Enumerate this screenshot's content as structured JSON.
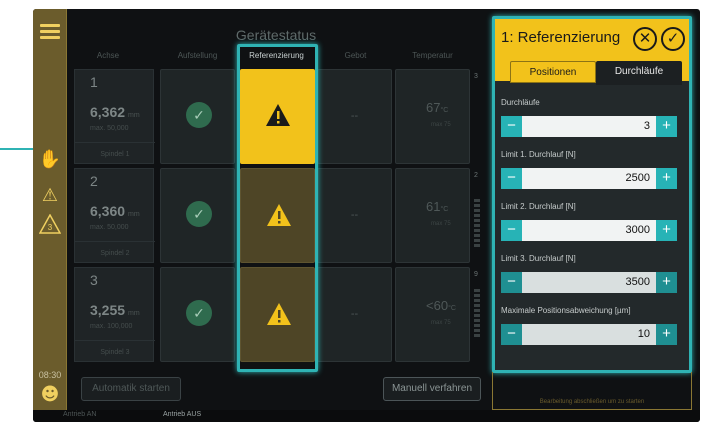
{
  "header": {
    "title": "Gerätestatus"
  },
  "columns": [
    "Achse",
    "Aufstellung",
    "Referenzierung",
    "Gebot",
    "Temperatur"
  ],
  "rows": [
    {
      "num": "1",
      "value": "6,362",
      "unit": "mm",
      "max": "max. 50,000",
      "feed": "Spindel 1",
      "temp": "67",
      "temp_unit": "°C",
      "temp_max": "max 75",
      "side": "3"
    },
    {
      "num": "2",
      "value": "6,360",
      "unit": "mm",
      "max": "max. 50,000",
      "feed": "Spindel 2",
      "temp": "61",
      "temp_unit": "°C",
      "temp_max": "max 75",
      "side": "2"
    },
    {
      "num": "3",
      "value": "3,255",
      "unit": "mm",
      "max": "max. 100,000",
      "feed": "Spindel 3",
      "temp": "<60",
      "temp_unit": "°C",
      "temp_max": "max 75",
      "side": "9"
    }
  ],
  "dash": "--",
  "rail": {
    "time": "08:30",
    "tri_number": "3"
  },
  "buttons": {
    "auto": "Automatik starten",
    "manual": "Manuell verfahren"
  },
  "statusbar": {
    "left": "Antrieb AN",
    "right": "Antrieb AUS"
  },
  "panel": {
    "title": "1: Referenzierung",
    "tabs": [
      "Positionen",
      "Durchläufe"
    ],
    "active_tab": "Durchläufe",
    "fields": [
      {
        "label": "Durchläufe",
        "value": "3"
      },
      {
        "label": "Limit 1. Durchlauf [N]",
        "value": "2500"
      },
      {
        "label": "Limit 2. Durchlauf [N]",
        "value": "3000"
      },
      {
        "label": "Limit 3. Durchlauf [N]",
        "value": "3500"
      },
      {
        "label": "Maximale Positionsabweichung [µm]",
        "value": "10"
      }
    ],
    "footer_hint": "Bearbeitung abschließen um zu starten"
  },
  "colors": {
    "accent": "#2fb3b4",
    "warning": "#f2c21b",
    "ok": "#2f6b4e"
  }
}
